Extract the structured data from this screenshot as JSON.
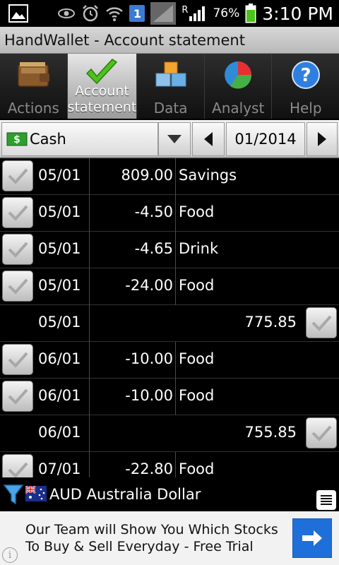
{
  "status_bar": {
    "sim_badge": "1",
    "roaming": "R",
    "battery_pct": "76%",
    "time": "3:10 PM"
  },
  "title": "HandWallet - Account statement",
  "tabs": [
    {
      "label": "Actions",
      "icon": "wallet-icon",
      "active": false
    },
    {
      "label": "Account\nstatement",
      "icon": "checkmark-icon",
      "active": true
    },
    {
      "label": "Data",
      "icon": "cubes-icon",
      "active": false
    },
    {
      "label": "Analyst",
      "icon": "pie-chart-icon",
      "active": false
    },
    {
      "label": "Help",
      "icon": "help-icon",
      "active": false
    }
  ],
  "selector": {
    "account": "Cash",
    "period": "01/2014"
  },
  "statement_rows": [
    {
      "type": "entry",
      "date": "05/01",
      "amount": "809.00",
      "category": "Savings"
    },
    {
      "type": "entry",
      "date": "05/01",
      "amount": "-4.50",
      "category": "Food"
    },
    {
      "type": "entry",
      "date": "05/01",
      "amount": "-4.65",
      "category": "Drink"
    },
    {
      "type": "entry",
      "date": "05/01",
      "amount": "-24.00",
      "category": "Food"
    },
    {
      "type": "balance",
      "date": "05/01",
      "balance": "775.85"
    },
    {
      "type": "entry",
      "date": "06/01",
      "amount": "-10.00",
      "category": "Food"
    },
    {
      "type": "entry",
      "date": "06/01",
      "amount": "-10.00",
      "category": "Food"
    },
    {
      "type": "balance",
      "date": "06/01",
      "balance": "755.85"
    },
    {
      "type": "entry",
      "date": "07/01",
      "amount": "-22.80",
      "category": "Food"
    }
  ],
  "currency": {
    "label": "AUD Australia Dollar"
  },
  "ad": {
    "text": "Our Team will Show You Which Stocks To Buy & Sell Everyday - Free Trial",
    "info": "i"
  },
  "colors": {
    "active_tab": "#cfcfcf",
    "ad_button": "#1e6fd9",
    "check_green": "#4cc31c"
  }
}
